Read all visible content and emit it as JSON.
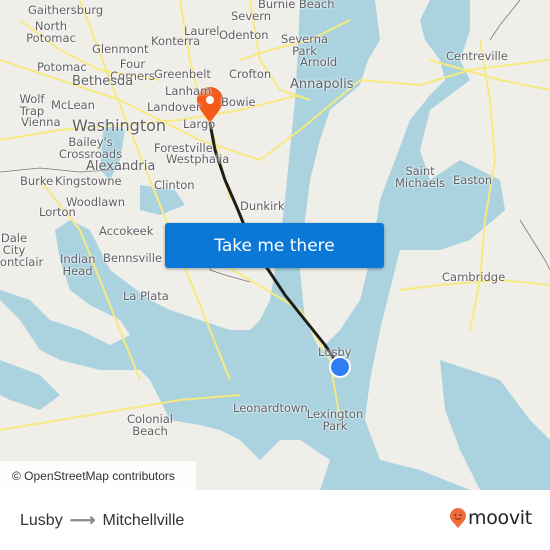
{
  "map": {
    "labels": [
      {
        "text": "Gaithersburg",
        "cls": ""
      },
      {
        "text": "North Potomac",
        "cls": ""
      },
      {
        "text": "Laurel",
        "cls": ""
      },
      {
        "text": "Konterra",
        "cls": ""
      },
      {
        "text": "Severn",
        "cls": ""
      },
      {
        "text": "Burnie Beach",
        "cls": ""
      },
      {
        "text": "Odenton",
        "cls": ""
      },
      {
        "text": "Severna Park",
        "cls": ""
      },
      {
        "text": "Glenmont",
        "cls": ""
      },
      {
        "text": "Four Corners",
        "cls": ""
      },
      {
        "text": "Potomac",
        "cls": ""
      },
      {
        "text": "Greenbelt",
        "cls": ""
      },
      {
        "text": "Crofton",
        "cls": ""
      },
      {
        "text": "Arnold",
        "cls": ""
      },
      {
        "text": "Centreville",
        "cls": ""
      },
      {
        "text": "Bethesda",
        "cls": "med"
      },
      {
        "text": "Lanham",
        "cls": ""
      },
      {
        "text": "Bowie",
        "cls": ""
      },
      {
        "text": "Annapolis",
        "cls": "med"
      },
      {
        "text": "Wolf Trap",
        "cls": ""
      },
      {
        "text": "McLean",
        "cls": ""
      },
      {
        "text": "Landover",
        "cls": ""
      },
      {
        "text": "Vienna",
        "cls": ""
      },
      {
        "text": "Washington",
        "cls": "big"
      },
      {
        "text": "Largo",
        "cls": ""
      },
      {
        "text": "Bailey's Crossroads",
        "cls": ""
      },
      {
        "text": "Forestville",
        "cls": ""
      },
      {
        "text": "Westphalia",
        "cls": ""
      },
      {
        "text": "Alexandria",
        "cls": "med"
      },
      {
        "text": "Saint Michaels",
        "cls": ""
      },
      {
        "text": "Easton",
        "cls": ""
      },
      {
        "text": "Burke",
        "cls": ""
      },
      {
        "text": "Kingstowne",
        "cls": ""
      },
      {
        "text": "Clinton",
        "cls": ""
      },
      {
        "text": "Woodlawn",
        "cls": ""
      },
      {
        "text": "Lorton",
        "cls": ""
      },
      {
        "text": "Dunkirk",
        "cls": ""
      },
      {
        "text": "Accokeek",
        "cls": ""
      },
      {
        "text": "Dale City",
        "cls": ""
      },
      {
        "text": "Montclair",
        "cls": ""
      },
      {
        "text": "Indian Head",
        "cls": ""
      },
      {
        "text": "Bennsville",
        "cls": ""
      },
      {
        "text": "Cambridge",
        "cls": ""
      },
      {
        "text": "La Plata",
        "cls": ""
      },
      {
        "text": "Lusby",
        "cls": ""
      },
      {
        "text": "Colonial Beach",
        "cls": ""
      },
      {
        "text": "Leonardtown",
        "cls": ""
      },
      {
        "text": "Lexington Park",
        "cls": ""
      }
    ],
    "destination_pin_color": "#f55a1c",
    "origin_dot_color": "#2f7ef5",
    "route_color": "#1e1e1e",
    "water_color": "#aad3df",
    "road_color": "#f7e980"
  },
  "cta": {
    "label": "Take me there",
    "color": "#0b77d6"
  },
  "attribution": "© OpenStreetMap contributors",
  "footer": {
    "origin": "Lusby",
    "arrow": "⟶",
    "destination": "Mitchellville",
    "logo_text": "moovit",
    "logo_color": "#f26b3a"
  }
}
